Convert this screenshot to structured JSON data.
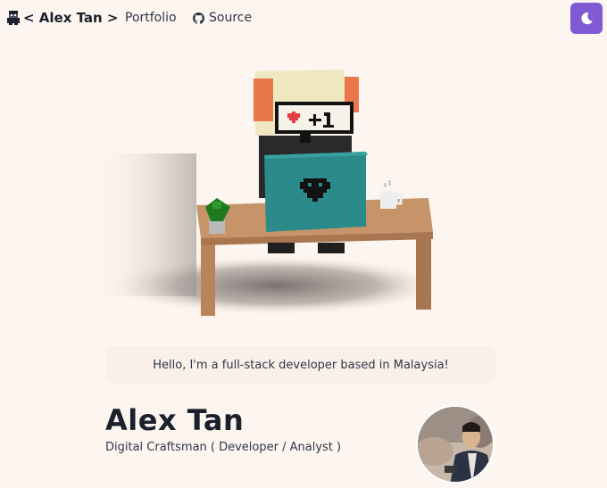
{
  "nav": {
    "brand": "< Alex Tan >",
    "portfolio": "Portfolio",
    "source": "Source"
  },
  "greeting": "Hello, I'm a full-stack developer based in Malaysia!",
  "profile": {
    "name": "Alex Tan",
    "subtitle": "Digital Craftsman ( Developer / Analyst )"
  },
  "colors": {
    "background": "#fdf5ef",
    "accent": "#805ad5",
    "text": "#1a202c"
  },
  "icons": {
    "brand": "pixel-avatar-icon",
    "source": "github-icon",
    "theme": "moon-icon"
  }
}
